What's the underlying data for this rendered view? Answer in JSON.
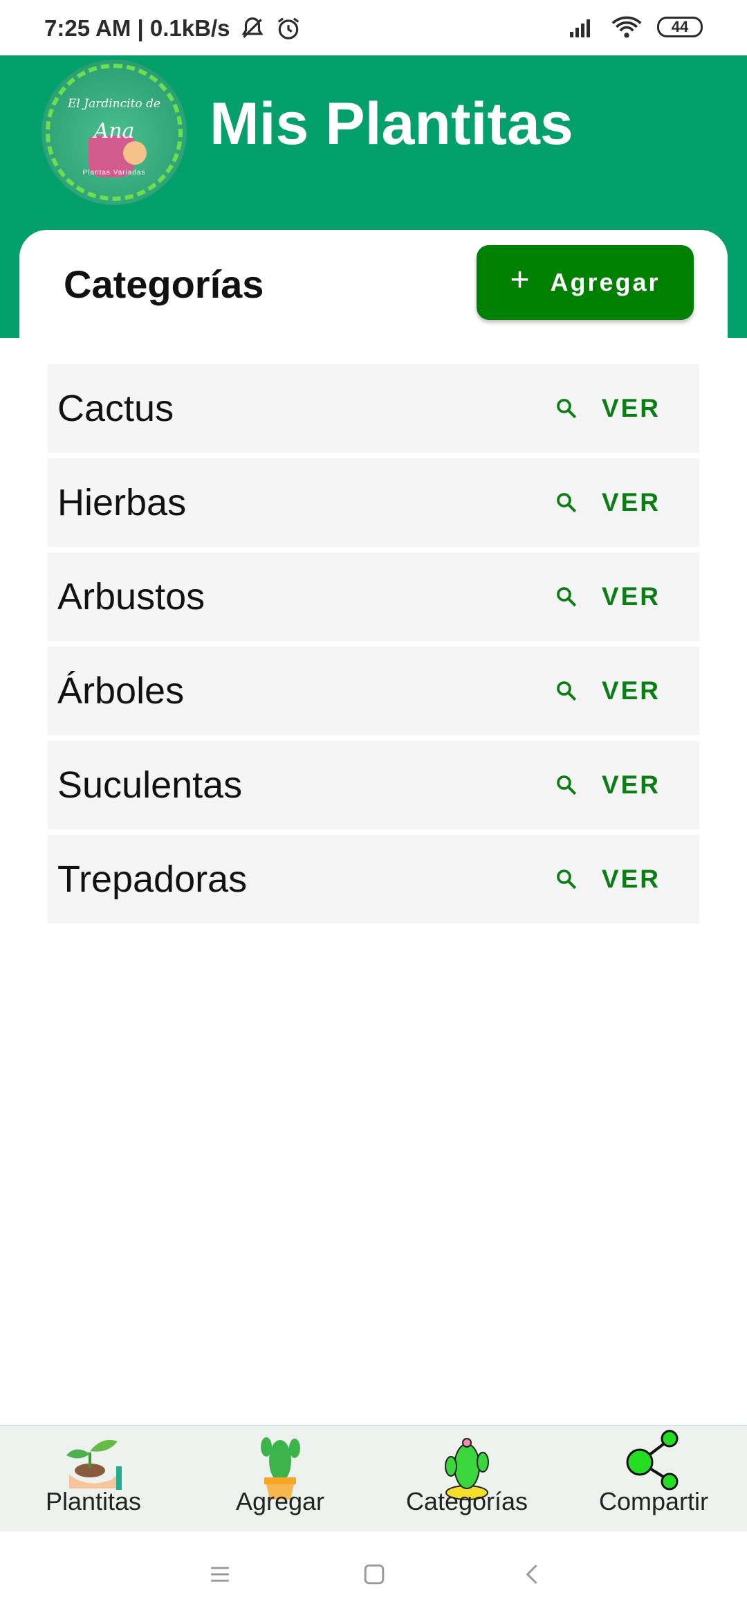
{
  "status_bar": {
    "time_speed": "7:25 AM | 0.1kB/s",
    "battery": "44",
    "icons": [
      "mute-icon",
      "alarm-icon",
      "signal-icon",
      "wifi-icon",
      "battery-icon"
    ]
  },
  "header": {
    "logo_text_line1": "El Jardincito de",
    "logo_text_line2": "Ana",
    "logo_text_sub": "Plantas Variadas",
    "title": "Mis Plantitas",
    "background_color": "#03a06b"
  },
  "section": {
    "title": "Categorías",
    "add_button": {
      "icon": "plus-icon",
      "label": "Agregar",
      "color": "#008000"
    }
  },
  "categories": [
    {
      "name": "Cactus",
      "action": "VER",
      "icon": "search-icon"
    },
    {
      "name": "Hierbas",
      "action": "VER",
      "icon": "search-icon"
    },
    {
      "name": "Arbustos",
      "action": "VER",
      "icon": "search-icon"
    },
    {
      "name": "Árboles",
      "action": "VER",
      "icon": "search-icon"
    },
    {
      "name": "Suculentas",
      "action": "VER",
      "icon": "search-icon"
    },
    {
      "name": "Trepadoras",
      "action": "VER",
      "icon": "search-icon"
    }
  ],
  "bottom_nav": [
    {
      "label": "Plantitas",
      "icon": "sprout-hand-icon"
    },
    {
      "label": "Agregar",
      "icon": "potted-cactus-icon"
    },
    {
      "label": "Categorías",
      "icon": "cactus-icon"
    },
    {
      "label": "Compartir",
      "icon": "share-icon"
    }
  ],
  "system_nav": [
    "menu-icon",
    "home-icon",
    "back-icon"
  ]
}
